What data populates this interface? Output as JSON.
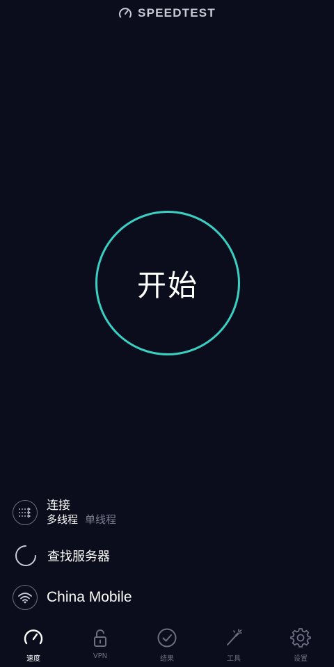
{
  "header": {
    "title": "SPEEDTEST",
    "icon": "speedometer-icon"
  },
  "main": {
    "start_label": "开始",
    "ring_color": "#39d0c3"
  },
  "connection": {
    "title": "连接",
    "modes": [
      {
        "label": "多线程",
        "selected": true
      },
      {
        "label": "单线程",
        "selected": false
      }
    ],
    "icon": "multi-connection-icon"
  },
  "server": {
    "label": "查找服务器",
    "icon": "loading-spinner-icon"
  },
  "provider": {
    "label": "China Mobile",
    "icon": "wifi-icon"
  },
  "tabs": [
    {
      "label": "速度",
      "icon": "speedometer-icon",
      "active": true
    },
    {
      "label": "VPN",
      "icon": "unlock-icon",
      "active": false
    },
    {
      "label": "结果",
      "icon": "check-circle-icon",
      "active": false
    },
    {
      "label": "工具",
      "icon": "magic-wand-icon",
      "active": false
    },
    {
      "label": "设置",
      "icon": "gear-icon",
      "active": false
    }
  ]
}
